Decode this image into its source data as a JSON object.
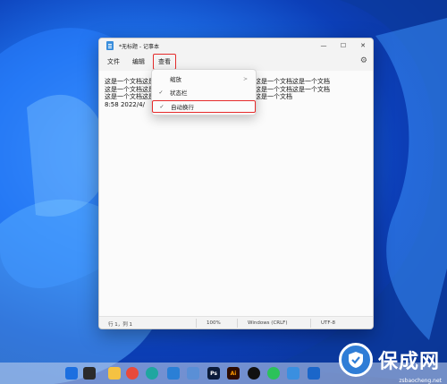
{
  "window": {
    "title": "*无标题 - 记事本",
    "minimize": "—",
    "maximize": "☐",
    "close": "✕"
  },
  "menu": {
    "file": "文件",
    "edit": "编辑",
    "view": "查看"
  },
  "editor": {
    "lines": [
      "这是一个文档这是一个文档这是一个文档这是一个文档这是一个文档这是一个文档",
      "这是一个文档这是一个文档这是一个文档这是一个文档这是一个文档这是一个文档",
      "这是一个文档这是一个文档这是一个文档这是一个文档这是一个文档",
      "8:58 2022/4/"
    ]
  },
  "view_menu": {
    "zoom": "缩放",
    "zoom_arrow": ">",
    "status_bar": "状态栏",
    "status_bar_check": "✓",
    "word_wrap": "自动换行",
    "word_wrap_check": "✓"
  },
  "statusbar": {
    "position": "行 1，列 1",
    "zoom": "100%",
    "line_ending": "Windows (CRLF)",
    "encoding": "UTF-8"
  },
  "watermark": {
    "text": "保成网",
    "url": "zsbaocheng.net"
  },
  "taskbar": {
    "icons": [
      "windows-start-icon",
      "task-view-icon",
      "file-explorer-icon",
      "chrome-icon",
      "edge-icon",
      "vscode-icon",
      "notepad-icon",
      "photoshop-icon",
      "illustrator-icon",
      "qq-icon",
      "wechat-icon",
      "app-icon",
      "store-icon"
    ],
    "labels": {
      "ps": "Ps",
      "ai": "Ai"
    }
  },
  "colors": {
    "highlight_border": "#e52b2b",
    "wallpaper_blue": "#1e6fe8"
  }
}
